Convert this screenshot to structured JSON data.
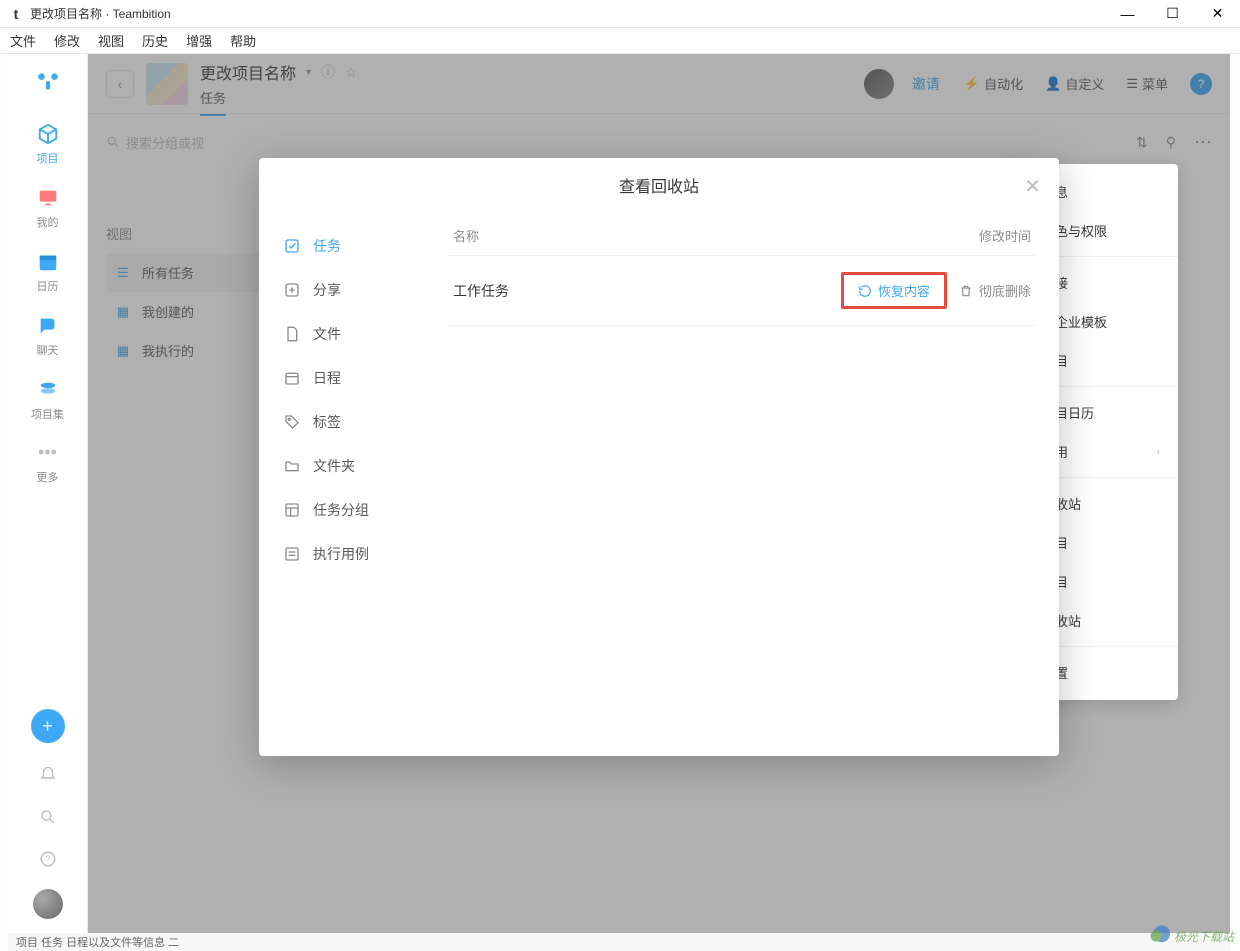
{
  "window": {
    "title": "更改项目名称 · Teambition",
    "appicon": "t"
  },
  "menubar": [
    "文件",
    "修改",
    "视图",
    "历史",
    "增强",
    "帮助"
  ],
  "leftbar": {
    "items": [
      {
        "label": "项目",
        "icon": "cube"
      },
      {
        "label": "我的",
        "icon": "monitor"
      },
      {
        "label": "日历",
        "icon": "calendar"
      },
      {
        "label": "聊天",
        "icon": "chat"
      },
      {
        "label": "项目集",
        "icon": "stack"
      }
    ],
    "more": "更多"
  },
  "project": {
    "title": "更改项目名称",
    "tab": "任务",
    "invite": "邀请",
    "auto": "自动化",
    "custom": "自定义",
    "menu": "菜单"
  },
  "toolbar": {
    "search_placeholder": "搜索分组或视",
    "view_label": "视图"
  },
  "views": [
    {
      "label": "所有任务",
      "icon": "bars",
      "active": true
    },
    {
      "label": "我创建的",
      "icon": "grid",
      "lock": true
    },
    {
      "label": "我执行的",
      "icon": "grid",
      "lock": true
    }
  ],
  "dropdown": [
    {
      "label": "项目信息"
    },
    {
      "label": "项目角色与权限"
    },
    {
      "sep": true
    },
    {
      "label": "复制链接"
    },
    {
      "label": "保存为企业模板"
    },
    {
      "label": "复制项目"
    },
    {
      "sep": true
    },
    {
      "label": "订阅项目日历"
    },
    {
      "label": "拓展应用",
      "chevron": true
    },
    {
      "sep": true
    },
    {
      "label": "查看回收站"
    },
    {
      "label": "归档项目"
    },
    {
      "label": "退出项目"
    },
    {
      "label": "移到回收站"
    },
    {
      "sep": true
    },
    {
      "label": "更多设置"
    }
  ],
  "modal": {
    "title": "查看回收站",
    "sidebar": [
      {
        "label": "任务",
        "icon": "check-square",
        "active": true
      },
      {
        "label": "分享",
        "icon": "share"
      },
      {
        "label": "文件",
        "icon": "file"
      },
      {
        "label": "日程",
        "icon": "calendar"
      },
      {
        "label": "标签",
        "icon": "tag"
      },
      {
        "label": "文件夹",
        "icon": "folder"
      },
      {
        "label": "任务分组",
        "icon": "layout"
      },
      {
        "label": "执行用例",
        "icon": "list-check"
      }
    ],
    "columns": {
      "name": "名称",
      "time": "修改时间"
    },
    "row": {
      "name": "工作任务",
      "restore": "恢复内容",
      "delete": "彻底删除"
    }
  },
  "bottom": "项目  任务  日程以及文件等信息   二",
  "watermark": "极光下载站"
}
